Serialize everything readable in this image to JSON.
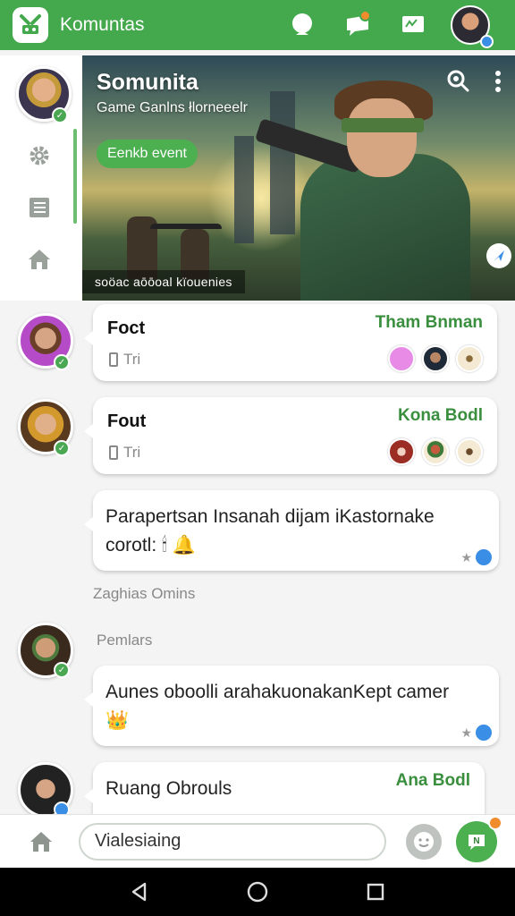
{
  "app": {
    "title": "Komuntas"
  },
  "colors": {
    "brand_green": "#44a84c",
    "accent_orange": "#f08c2c",
    "link_blue": "#3a8ee6"
  },
  "header": {
    "icons": [
      "chat-bubble-icon",
      "message-icon",
      "news-icon"
    ],
    "notification_badge": true
  },
  "rail": {
    "items": [
      {
        "icon": "settings-icon"
      },
      {
        "icon": "list-icon"
      },
      {
        "icon": "home-icon"
      }
    ]
  },
  "banner": {
    "title": "Somunita",
    "subtitle": "Game Ganlns łlorneeelr",
    "button_label": "Eenkb event",
    "caption": "soöac aōōoal kïouenies"
  },
  "feed": {
    "posts": [
      {
        "name": "Foct",
        "tag": "Tham Bnman",
        "meta": "Tri"
      },
      {
        "name": "Fout",
        "tag": "Kona Bodl",
        "meta": "Tri"
      }
    ],
    "message1": {
      "text": "Parapertsan Insanah dijam iKastornake corotl: 🕯 🔔"
    },
    "section1": "Zaghias Omins",
    "section2": "Pemlars",
    "message2": {
      "text": "Aunes oboolli arahakuonakanKept camer 👑"
    },
    "post3": {
      "name": "Ruang Obrouls",
      "tag": "Ana Bodl"
    }
  },
  "input": {
    "placeholder": "Vialesiaing",
    "send_label": "N"
  }
}
